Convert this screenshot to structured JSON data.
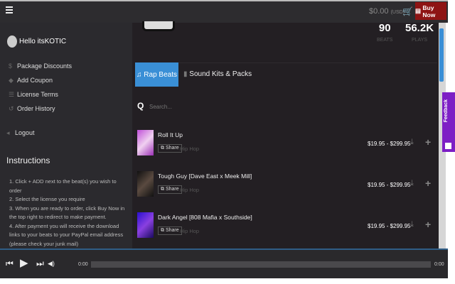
{
  "header": {
    "cart_total": "$0.00",
    "currency": "(USD)",
    "buy_now": "Buy Now",
    "cart_icon": "cart-icon"
  },
  "sidebar": {
    "greeting": "Hello itsKOTIC",
    "items": [
      {
        "label": "Package Discounts"
      },
      {
        "label": "Add Coupon"
      },
      {
        "label": "License Terms"
      },
      {
        "label": "Order History"
      }
    ],
    "logout": "Logout",
    "instructions_title": "Instructions",
    "instructions": [
      "1. Click + ADD next to the beat(s) you wish to order",
      "2. Select the license you require",
      "3. When you are ready to order, click Buy Now in the top right to redirect to make payment.",
      "4. After payment you will receive the download links to your beats to your PayPal email address (please check your junk mail)"
    ]
  },
  "stats": {
    "beats_value": "90",
    "beats_label": "BEATS",
    "plays_value": "56.2K",
    "plays_label": "PLAYS"
  },
  "tabs": [
    {
      "label": "Rap Beats"
    },
    {
      "label": "Sound Kits & Packs"
    }
  ],
  "search": {
    "placeholder": "Search..."
  },
  "tracks": [
    {
      "title": "Roll It Up",
      "share": "Share",
      "genre": "Hip Hop",
      "price": "$19.95 - $299.95"
    },
    {
      "title": "Tough Guy [Dave East x Meek Mill]",
      "share": "Share",
      "genre": "Hip Hop",
      "price": "$19.95 - $299.95"
    },
    {
      "title": "Dark Angel [808 Mafia x Southside]",
      "share": "Share",
      "genre": "Hip Hop",
      "price": "$19.95 - $299.95"
    }
  ],
  "feedback": "Feedback",
  "player": {
    "current": "0:00",
    "duration": "0:00",
    "progress": 0
  },
  "colors": {
    "accent": "#3a8fd6",
    "buy": "#8e1414",
    "feedback": "#7d1fc5"
  }
}
